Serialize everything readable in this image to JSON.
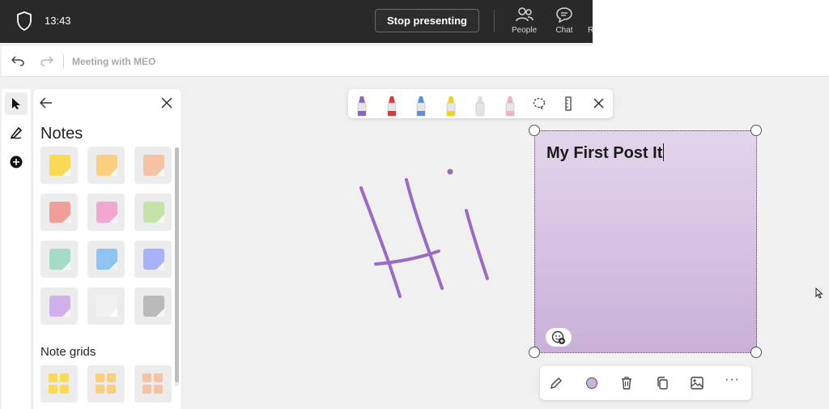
{
  "teams_bar": {
    "time": "13:43",
    "stop_presenting_label": "Stop presenting",
    "people_label": "People",
    "chat_label": "Chat",
    "cut_label": "R"
  },
  "whiteboard": {
    "title": "Meeting with MEO"
  },
  "rail": {
    "tools": [
      "select-pointer-icon",
      "pen-tool-icon",
      "add-circle-icon"
    ]
  },
  "notes_panel": {
    "heading": "Notes",
    "note_colors": [
      "#fad957",
      "#f9cf7f",
      "#f6c2a5",
      "#f19e9a",
      "#f1a7d0",
      "#c5e3a8",
      "#a4dcc6",
      "#8ec3f2",
      "#a7b2f8",
      "#cfb0ec",
      "#f1f1f1",
      "#b9b9b9"
    ],
    "grids_heading": "Note grids",
    "grid_colors": [
      "#fad957",
      "#f9cf7f",
      "#f6c2a5"
    ]
  },
  "pen_toolbar": {
    "pens": [
      {
        "name": "purple-pen-icon",
        "color": "#8a63c8"
      },
      {
        "name": "red-pen-icon",
        "color": "#d83b3b"
      },
      {
        "name": "multicolor-pen-icon",
        "color": "#5b8fd8"
      },
      {
        "name": "yellow-highlighter-icon",
        "color": "#f2d024"
      },
      {
        "name": "pencil-icon",
        "color": "#e0e0e0"
      },
      {
        "name": "eraser-icon",
        "color": "#f3b3bd"
      }
    ]
  },
  "sticky_note": {
    "text": "My First Post It",
    "color": "#d9c6e4"
  },
  "context_toolbar": {
    "color_swatch": "#c9b3d9",
    "more_label": "···"
  },
  "ink": {
    "color": "#9b6ac4"
  }
}
